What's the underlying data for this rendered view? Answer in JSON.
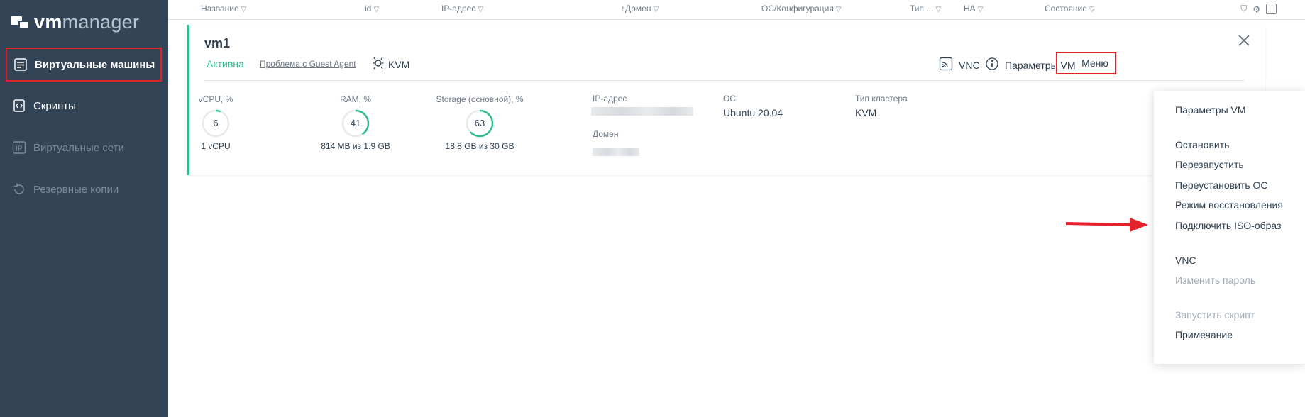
{
  "sidebar": {
    "logo": {
      "brand_bold": "vm",
      "brand_light": "manager"
    },
    "items": [
      {
        "label": "Виртуальные машины",
        "icon": "vm-list-icon",
        "state": "active"
      },
      {
        "label": "Скрипты",
        "icon": "script-icon",
        "state": "normal"
      },
      {
        "label": "Виртуальные сети",
        "icon": "ip-network-icon",
        "state": "disabled"
      },
      {
        "label": "Резервные копии",
        "icon": "backup-icon",
        "state": "disabled"
      }
    ]
  },
  "table_header": {
    "columns": [
      "Название",
      "id",
      "IP-адрес",
      "↑Домен",
      "ОС/Конфигурация",
      "Тип ...",
      "HA",
      "Состояние"
    ]
  },
  "vm": {
    "name": "vm1",
    "status": "Активна",
    "problem": "Проблема с Guest Agent",
    "hypervisor": "KVM",
    "actions": {
      "vnc": "VNC",
      "params": "Параметры VM",
      "menu": "Меню"
    },
    "metrics": [
      {
        "label": "vCPU, %",
        "value": "6",
        "sub": "1 vCPU"
      },
      {
        "label": "RAM, %",
        "value": "41",
        "sub": "814 MB из 1.9 GB"
      },
      {
        "label": "Storage (основной), %",
        "value": "63",
        "sub": "18.8 GB из 30 GB"
      }
    ],
    "fields": {
      "ip_label": "IP-адрес",
      "domain_label": "Домен",
      "os_label": "ОС",
      "os_value": "Ubuntu 20.04",
      "cluster_label": "Тип кластера",
      "cluster_value": "KVM"
    }
  },
  "dropdown_menu": {
    "items": [
      {
        "label": "Параметры VM",
        "disabled": false
      },
      {
        "label": "Остановить",
        "disabled": false
      },
      {
        "label": "Перезапустить",
        "disabled": false
      },
      {
        "label": "Переустановить ОС",
        "disabled": false
      },
      {
        "label": "Режим восстановления",
        "disabled": false
      },
      {
        "label": "Подключить ISO-образ",
        "disabled": false
      },
      {
        "label": "VNC",
        "disabled": false
      },
      {
        "label": "Изменить пароль",
        "disabled": true
      },
      {
        "label": "Запустить скрипт",
        "disabled": true
      },
      {
        "label": "Примечание",
        "disabled": false
      }
    ]
  },
  "colors": {
    "sidebar_bg": "#344457",
    "accent_green": "#2dbd8a",
    "highlight_red": "#e3222c"
  }
}
